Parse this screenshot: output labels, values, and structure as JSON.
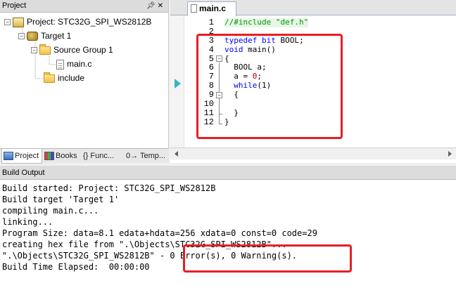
{
  "project_pane": {
    "title": "Project",
    "controls": " ×",
    "tree": {
      "project": "Project: STC32G_SPI_WS2812B",
      "target": "Target 1",
      "source_group": "Source Group 1",
      "file": "main.c",
      "include": "include"
    },
    "tabs": [
      {
        "label": "Project"
      },
      {
        "label": "Books"
      },
      {
        "label": "{} Func..."
      },
      {
        "label": "0→ Temp..."
      }
    ]
  },
  "editor": {
    "tab_label": "main.c",
    "lines": [
      "1",
      "2",
      "3",
      "4",
      "5",
      "6",
      "7",
      "8",
      "9",
      "10",
      "11",
      "12"
    ],
    "code": {
      "l1": "//#include \"def.h\"",
      "l3_kw": "typedef bit",
      "l3_rest": " BOOL;",
      "l4_kw": "void",
      "l4_rest": " main()",
      "l5": "{",
      "l6": "  BOOL a;",
      "l7_a": "  a = ",
      "l7_num": "0",
      "l7_b": ";",
      "l8_kw": "  while",
      "l8_rest": "(1)",
      "l9": "  {",
      "l10": "",
      "l11": "  }",
      "l12": "}"
    }
  },
  "build_output": {
    "title": "Build Output",
    "lines": [
      "Build started: Project: STC32G_SPI_WS2812B",
      "Build target 'Target 1'",
      "compiling main.c...",
      "linking...",
      "Program Size: data=8.1 edata+hdata=256 xdata=0 const=0 code=29",
      "creating hex file from \".\\Objects\\STC32G_SPI_WS2812B\"...",
      "\".\\Objects\\STC32G_SPI_WS2812B\" - 0 Error(s), 0 Warning(s).",
      "Build Time Elapsed:  00:00:00"
    ]
  },
  "colors": {
    "annotation": "#e81e25",
    "comment": "#009900",
    "keyword": "#0000ff",
    "number": "#b00000"
  }
}
